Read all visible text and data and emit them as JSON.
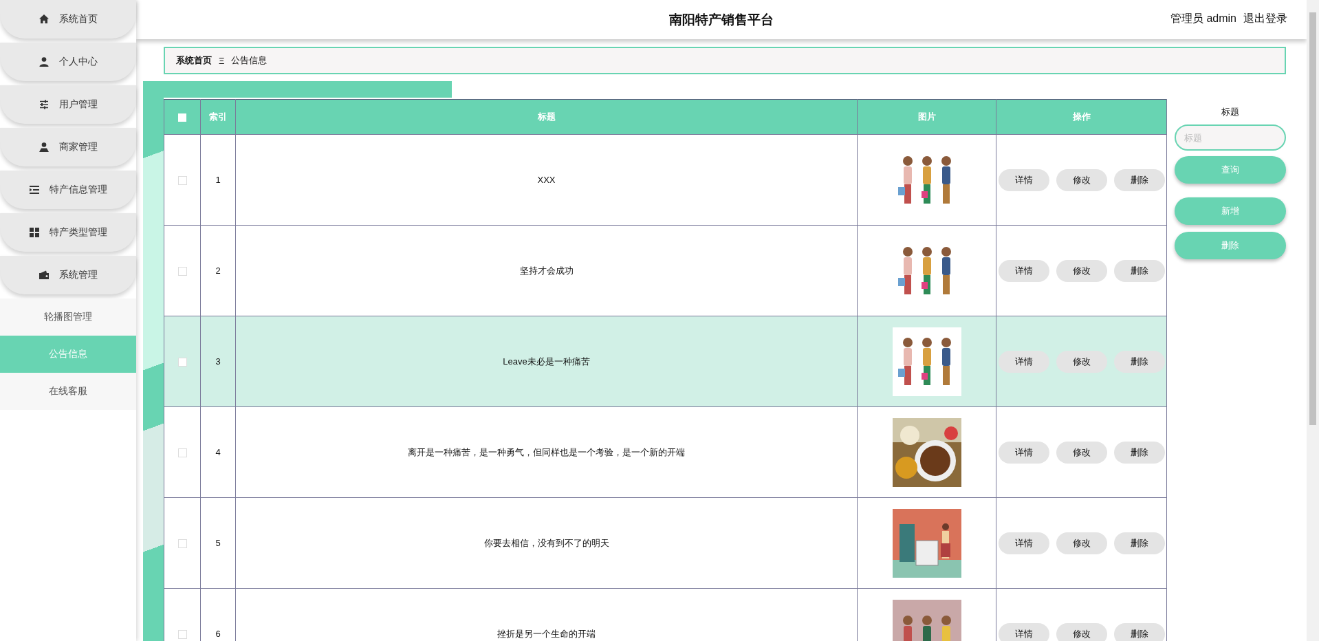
{
  "sidebar": {
    "items": [
      {
        "label": "系统首页",
        "selected": false
      },
      {
        "label": "个人中心",
        "selected": false
      },
      {
        "label": "用户管理",
        "selected": false
      },
      {
        "label": "商家管理",
        "selected": false
      },
      {
        "label": "特产信息管理",
        "selected": false
      },
      {
        "label": "特产类型管理",
        "selected": false
      },
      {
        "label": "系统管理",
        "selected": false,
        "children": [
          {
            "label": "轮播图管理",
            "selected": false
          },
          {
            "label": "公告信息",
            "selected": true
          },
          {
            "label": "在线客服",
            "selected": false
          }
        ]
      }
    ]
  },
  "header": {
    "title": "南阳特产销售平台",
    "user": "管理员 admin",
    "logout": "退出登录"
  },
  "breadcrumb": {
    "home": "系统首页",
    "separator": "Ξ",
    "current": "公告信息"
  },
  "table": {
    "columns": [
      "索引",
      "标题",
      "图片",
      "操作"
    ],
    "header_checked": false,
    "rows": [
      {
        "checked": false,
        "highlighted": false,
        "index": "1",
        "title": "XXX",
        "picture": {
          "kind": "picture"
        },
        "actions": [
          "详情",
          "修改",
          "删除"
        ]
      },
      {
        "checked": false,
        "highlighted": false,
        "index": "2",
        "title": "坚持才会成功",
        "picture": {
          "kind": "picture"
        },
        "actions": [
          "详情",
          "修改",
          "删除"
        ]
      },
      {
        "checked": false,
        "highlighted": true,
        "index": "3",
        "title": "Leave未必是一种痛苦",
        "picture": {
          "kind": "picture"
        },
        "actions": [
          "详情",
          "修改",
          "删除"
        ]
      },
      {
        "checked": false,
        "highlighted": false,
        "index": "4",
        "title": "离开是一种痛苦，是一种勇气，但同样也是一个考验，是一个新的开端",
        "picture": {
          "kind": "picture"
        },
        "actions": [
          "详情",
          "修改",
          "删除"
        ]
      },
      {
        "checked": false,
        "highlighted": false,
        "index": "5",
        "title": "你要去相信，没有到不了的明天",
        "picture": {
          "kind": "picture"
        },
        "actions": [
          "详情",
          "修改",
          "删除"
        ]
      },
      {
        "checked": false,
        "highlighted": false,
        "index": "6",
        "title": "挫折是另一个生命的开端",
        "picture": {
          "kind": "picture"
        },
        "actions": [
          "详情",
          "修改",
          "删除"
        ]
      }
    ]
  },
  "search": {
    "label": "标题",
    "placeholder": "标题",
    "buttons": [
      "查询",
      "新增",
      "删除"
    ]
  }
}
